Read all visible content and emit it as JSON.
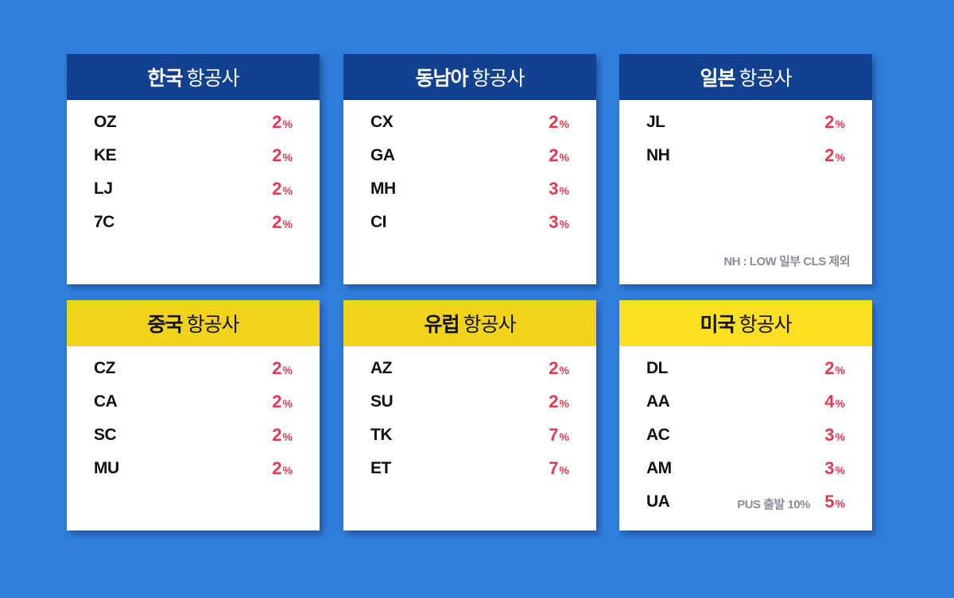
{
  "cards": [
    {
      "region": "한국",
      "suffix": "항공사",
      "rows": [
        {
          "code": "OZ",
          "value": "2",
          "unit": "%"
        },
        {
          "code": "KE",
          "value": "2",
          "unit": "%"
        },
        {
          "code": "LJ",
          "value": "2",
          "unit": "%"
        },
        {
          "code": "7C",
          "value": "2",
          "unit": "%"
        }
      ]
    },
    {
      "region": "동남아",
      "suffix": "항공사",
      "rows": [
        {
          "code": "CX",
          "value": "2",
          "unit": "%"
        },
        {
          "code": "GA",
          "value": "2",
          "unit": "%"
        },
        {
          "code": "MH",
          "value": "3",
          "unit": "%"
        },
        {
          "code": "CI",
          "value": "3",
          "unit": "%"
        }
      ]
    },
    {
      "region": "일본",
      "suffix": "항공사",
      "rows": [
        {
          "code": "JL",
          "value": "2",
          "unit": "%"
        },
        {
          "code": "NH",
          "value": "2",
          "unit": "%"
        }
      ],
      "note": "NH : LOW 일부 CLS 제외"
    },
    {
      "region": "중국",
      "suffix": "항공사",
      "rows": [
        {
          "code": "CZ",
          "value": "2",
          "unit": "%"
        },
        {
          "code": "CA",
          "value": "2",
          "unit": "%"
        },
        {
          "code": "SC",
          "value": "2",
          "unit": "%"
        },
        {
          "code": "MU",
          "value": "2",
          "unit": "%"
        }
      ]
    },
    {
      "region": "유럽",
      "suffix": "항공사",
      "rows": [
        {
          "code": "AZ",
          "value": "2",
          "unit": "%"
        },
        {
          "code": "SU",
          "value": "2",
          "unit": "%"
        },
        {
          "code": "TK",
          "value": "7",
          "unit": "%"
        },
        {
          "code": "ET",
          "value": "7",
          "unit": "%"
        }
      ]
    },
    {
      "region": "미국",
      "suffix": "항공사",
      "rows": [
        {
          "code": "DL",
          "value": "2",
          "unit": "%"
        },
        {
          "code": "AA",
          "value": "4",
          "unit": "%"
        },
        {
          "code": "AC",
          "value": "3",
          "unit": "%"
        },
        {
          "code": "AM",
          "value": "3",
          "unit": "%"
        },
        {
          "code": "UA",
          "value": "5",
          "unit": "%",
          "note": "PUS 출발 10%"
        }
      ]
    }
  ],
  "colors": {
    "background": "#2f7ddc",
    "header_blue": "#12418f",
    "header_yellow": "#f2d31b",
    "percent_red": "#e8384f",
    "note_gray": "#8c8c97"
  }
}
